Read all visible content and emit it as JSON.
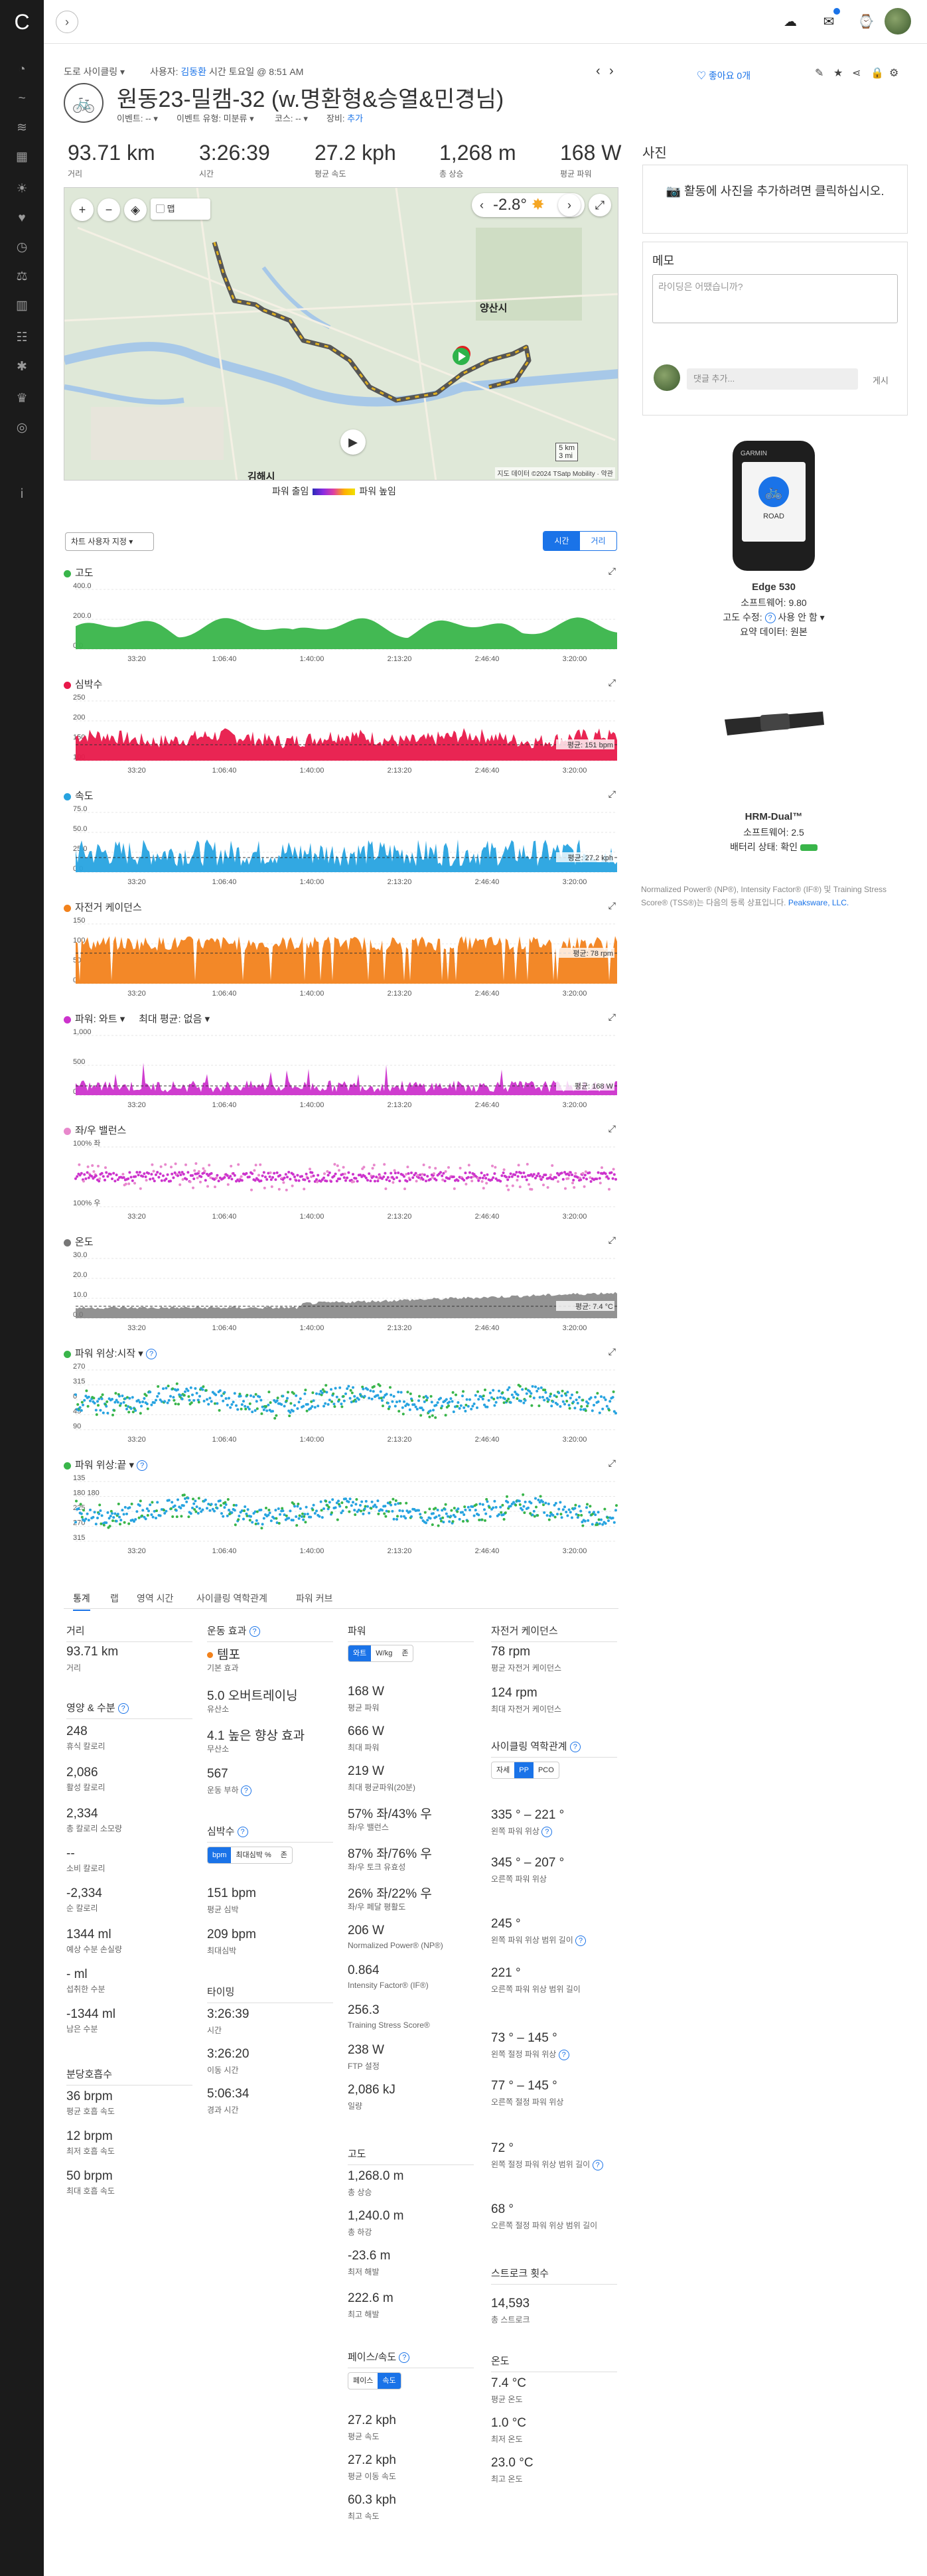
{
  "app": {
    "rail_icons": [
      "dashboard-icon",
      "training-icon",
      "activities-icon",
      "calendar-icon",
      "run-icon",
      "health-icon",
      "timer-icon",
      "scale-icon",
      "reports-icon",
      "groups-icon",
      "settings-icon",
      "trophy-icon",
      "target-icon",
      "info-icon"
    ],
    "colors": {
      "accent": "#1a73e8",
      "rail": "#1b1b1b"
    }
  },
  "header": {
    "activity_type": "도로 사이클링",
    "by_label": "사용자:",
    "user": "김동환",
    "time": "시간 토요일 @ 8:51 AM",
    "title": "원동23-밀캠-32 (w.명환형&승열&민경님)",
    "event_label": "이벤트: --",
    "event_type_label": "이벤트 유형: 미분류",
    "course_label": "코스: --",
    "gear_label": "장비:",
    "gear_add": "추가",
    "like_label": "좋아요 0개"
  },
  "stats": [
    {
      "value": "93.71 km",
      "label": "거리"
    },
    {
      "value": "3:26:39",
      "label": "시간"
    },
    {
      "value": "27.2 kph",
      "label": "평균 속도"
    },
    {
      "value": "1,268 m",
      "label": "총 상승"
    },
    {
      "value": "168 W",
      "label": "평균 파워"
    }
  ],
  "map": {
    "city1": "양산시",
    "city2": "김해시",
    "temp": "-2.8°",
    "layer_text": "▢ 맵",
    "scale1": "5 km",
    "scale2": "3 mi",
    "attribution": "지도 데이터 ©2024 TSatp Mobility · 약관",
    "legend_low": "파워 출임",
    "legend_high": "파워 높임"
  },
  "controls": {
    "axis_select": "차트 사용자 지정",
    "seg_time": "시간",
    "seg_distance": "거리"
  },
  "charts": [
    {
      "key": "elev",
      "title": "고도",
      "color": "#39b54a",
      "y_ticks": [
        "400.0",
        "200.0",
        "0.0"
      ],
      "avg_label": ""
    },
    {
      "key": "hr",
      "title": "심박수",
      "color": "#e8194a",
      "y_ticks": [
        "250",
        "200",
        "150",
        "100"
      ],
      "avg_label": "평균: 151 bpm"
    },
    {
      "key": "speed",
      "title": "속도",
      "color": "#27a3e0",
      "y_ticks": [
        "75.0",
        "50.0",
        "25.0",
        "0.0"
      ],
      "avg_label": "평균: 27.2 kph"
    },
    {
      "key": "cad",
      "title": "자전거 케이던스",
      "color": "#f2821c",
      "y_ticks": [
        "150",
        "100",
        "50",
        "0"
      ],
      "avg_label": "평균: 78 rpm"
    },
    {
      "key": "power",
      "title": "파워: 와트",
      "extra": "최대 평균: 없음",
      "color": "#cc33cc",
      "y_ticks": [
        "1,000",
        "500",
        "0"
      ],
      "avg_label": "평균: 168 W"
    },
    {
      "key": "balance",
      "title": "좌/우 밸런스",
      "color": "#cc33cc",
      "y_ticks": [
        "100% 좌",
        "100% 우"
      ],
      "avg_label": ""
    },
    {
      "key": "temp",
      "title": "온도",
      "color": "#777777",
      "y_ticks": [
        "30.0",
        "20.0",
        "10.0",
        "0.0"
      ],
      "avg_label": "평균: 7.4 °C"
    },
    {
      "key": "pps",
      "title": "파워 위상:시작",
      "color": "#39b54a",
      "y_ticks": [
        "270",
        "315",
        "0",
        "45",
        "90"
      ],
      "avg_label": ""
    },
    {
      "key": "ppe",
      "title": "파워 위상:끝",
      "color": "#39b54a",
      "y_ticks": [
        "135",
        "180 180",
        "225",
        "270",
        "315"
      ],
      "avg_label": ""
    }
  ],
  "x_ticks": [
    "33:20",
    "1:06:40",
    "1:40:00",
    "2:13:20",
    "2:46:40",
    "3:20:00"
  ],
  "right": {
    "photos_title": "사진",
    "photos_cta": "활동에 사진을 추가하려면 클릭하십시오.",
    "memo_title": "메모",
    "memo_placeholder": "라이딩은 어땠습니까?",
    "comment_placeholder": "댓글 추가...",
    "comment_post": "게시",
    "device1": {
      "name": "Edge 530",
      "sw": "소프트웨어: 9.80",
      "elev": "고도 수정:",
      "elev_val": "사용 안 함",
      "summary": "요약 데이터: 원본",
      "screen": "ROAD",
      "brand": "GARMIN"
    },
    "device2": {
      "name": "HRM-Dual™",
      "sw": "소프트웨어: 2.5",
      "battery": "배터리 상태: 확인"
    },
    "footnote": "Normalized Power® (NP®), Intensity Factor® (IF®) 및 Training Stress Score® (TSS®)는 다음의 등록 상표입니다.",
    "footnote_link": "Peaksware, LLC."
  },
  "tabs": [
    "통계",
    "랩",
    "영역 시간",
    "사이클링 역학관계",
    "파워 커브"
  ],
  "col1": {
    "dist_h": "거리",
    "dist_v": "93.71 km",
    "dist_l": "거리",
    "nut_h": "영양 & 수분",
    "rest_v": "248",
    "rest_l": "휴식 칼로리",
    "active_v": "2,086",
    "active_l": "활성 칼로리",
    "total_v": "2,334",
    "total_l": "총 칼로리 소모량",
    "consumed_v": "--",
    "consumed_l": "소비 칼로리",
    "net_v": "-2,334",
    "net_l": "순 칼로리",
    "sweat_v": "1344 ml",
    "sweat_l": "예상 수분 손실량",
    "intake_v": "- ml",
    "intake_l": "섭취한 수분",
    "remain_v": "-1344 ml",
    "remain_l": "남은 수분",
    "resp_h": "분당호흡수",
    "r1_v": "36 brpm",
    "r1_l": "평균 호흡 속도",
    "r2_v": "12 brpm",
    "r2_l": "최저 호흡 속도",
    "r3_v": "50 brpm",
    "r3_l": "최대 호흡 속도"
  },
  "col2": {
    "te_h": "운동 효과",
    "te1_v": "템포",
    "te1_l": "기본 효과",
    "te2_v": "5.0 오버트레이닝",
    "te2_l": "유산소",
    "te3_v": "4.1 높은 향상 효과",
    "te3_l": "무산소",
    "te4_v": "567",
    "te4_l": "운동 부하",
    "hr_h": "심박수",
    "hr_pills": [
      "bpm",
      "최대심박 %",
      "존"
    ],
    "hr1_v": "151 bpm",
    "hr1_l": "평균 심박",
    "hr2_v": "209 bpm",
    "hr2_l": "최대심박",
    "tm_h": "타이밍",
    "tm1_v": "3:26:39",
    "tm1_l": "시간",
    "tm2_v": "3:26:20",
    "tm2_l": "이동 시간",
    "tm3_v": "5:06:34",
    "tm3_l": "경과 시간"
  },
  "col3": {
    "pw_h": "파워",
    "pw_pills": [
      "와트",
      "W/kg",
      "존"
    ],
    "p1_v": "168 W",
    "p1_l": "평균 파워",
    "p2_v": "666 W",
    "p2_l": "최대 파워",
    "p3_v": "219 W",
    "p3_l": "최대 평균파워(20분)",
    "p4_v": "57% 좌/43% 우",
    "p4_l": "좌/우 밸런스",
    "p5_v": "87% 좌/76% 우",
    "p5_l": "좌/우 토크 유효성",
    "p6_v": "26% 좌/22% 우",
    "p6_l": "좌/우 페달 평활도",
    "p7_v": "206 W",
    "p7_l": "Normalized Power® (NP®)",
    "p8_v": "0.864",
    "p8_l": "Intensity Factor® (IF®)",
    "p9_v": "256.3",
    "p9_l": "Training Stress Score®",
    "p10_v": "238 W",
    "p10_l": "FTP 설정",
    "p11_v": "2,086 kJ",
    "p11_l": "일량",
    "el_h": "고도",
    "e1_v": "1,268.0 m",
    "e1_l": "총 상승",
    "e2_v": "1,240.0 m",
    "e2_l": "총 하강",
    "e3_v": "-23.6 m",
    "e3_l": "최저 해발",
    "e4_v": "222.6 m",
    "e4_l": "최고 해발",
    "sp_h": "페이스/속도",
    "sp_pills": [
      "페이스",
      "속도"
    ],
    "s1_v": "27.2 kph",
    "s1_l": "평균 속도",
    "s2_v": "27.2 kph",
    "s2_l": "평균 이동 속도",
    "s3_v": "60.3 kph",
    "s3_l": "최고 속도"
  },
  "col4": {
    "cad_h": "자전거 케이던스",
    "c1_v": "78 rpm",
    "c1_l": "평균 자전거 케이던스",
    "c2_v": "124 rpm",
    "c2_l": "최대 자전거 케이던스",
    "dyn_h": "사이클링 역학관계",
    "dyn_pills": [
      "자세",
      "PP",
      "PCO"
    ],
    "d1_v": "335 ° – 221 °",
    "d1_l": "왼쪽 파워 위상",
    "d2_v": "345 ° – 207 °",
    "d2_l": "오른쪽 파워 위상",
    "d3_v": "245 °",
    "d3_l": "왼쪽 파워 위상 범위 길이",
    "d4_v": "221 °",
    "d4_l": "오른쪽 파워 위상 범위 길이",
    "d5_v": "73 ° – 145 °",
    "d5_l": "왼쪽 절정 파워 위상",
    "d6_v": "77 ° – 145 °",
    "d6_l": "오른쪽 절정 파워 위상",
    "d7_v": "72 °",
    "d7_l": "왼쪽 절정 파워 위상 범위 길이",
    "d8_v": "68 °",
    "d8_l": "오른쪽 절정 파워 위상 범위 길이",
    "st_h": "스트로크 횟수",
    "st1_v": "14,593",
    "st1_l": "총 스트로크",
    "tp_h": "온도",
    "t1_v": "7.4 °C",
    "t1_l": "평균 온도",
    "t2_v": "1.0 °C",
    "t2_l": "최저 온도",
    "t3_v": "23.0 °C",
    "t3_l": "최고 온도"
  }
}
